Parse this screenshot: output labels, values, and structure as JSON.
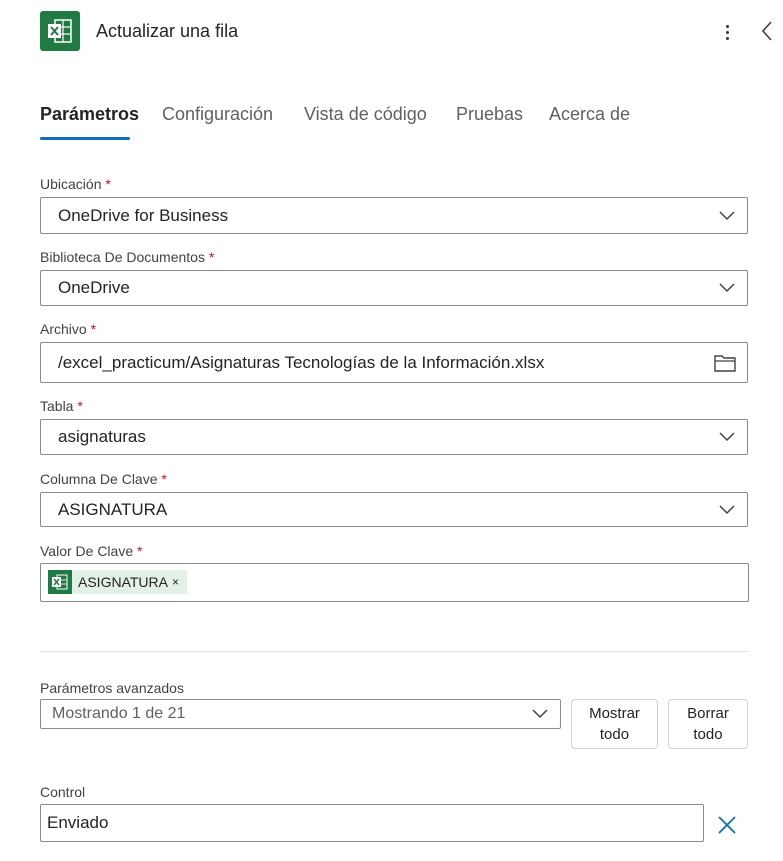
{
  "header": {
    "title": "Actualizar una fila"
  },
  "tabs": [
    {
      "label": "Parámetros",
      "active": true
    },
    {
      "label": "Configuración",
      "active": false
    },
    {
      "label": "Vista de código",
      "active": false
    },
    {
      "label": "Pruebas",
      "active": false
    },
    {
      "label": "Acerca de",
      "active": false
    }
  ],
  "fields": {
    "ubicacion": {
      "label": "Ubicación",
      "required": "*",
      "value": "OneDrive for Business"
    },
    "biblioteca": {
      "label": "Biblioteca De Documentos",
      "required": "*",
      "value": "OneDrive"
    },
    "archivo": {
      "label": "Archivo",
      "required": "*",
      "value": "/excel_practicum/Asignaturas Tecnologías de la Información.xlsx"
    },
    "tabla": {
      "label": "Tabla",
      "required": "*",
      "value": "asignaturas"
    },
    "columna": {
      "label": "Columna De Clave",
      "required": "*",
      "value": "ASIGNATURA"
    },
    "valor": {
      "label": "Valor De Clave",
      "required": "*",
      "token": "ASIGNATURA",
      "token_close": "×"
    }
  },
  "advanced": {
    "label": "Parámetros avanzados",
    "value": "Mostrando 1 de 21",
    "show_all": [
      "Mostrar",
      "todo"
    ],
    "clear_all": [
      "Borrar",
      "todo"
    ]
  },
  "control": {
    "label": "Control",
    "value": "Enviado"
  },
  "colors": {
    "accent": "#0f6cbd",
    "excel_green": "#1f7a43",
    "required": "#c50f1f"
  },
  "icons": [
    "excel-icon",
    "more-vertical-icon",
    "chevron-left-icon",
    "chevron-down-icon",
    "folder-icon",
    "close-icon"
  ]
}
